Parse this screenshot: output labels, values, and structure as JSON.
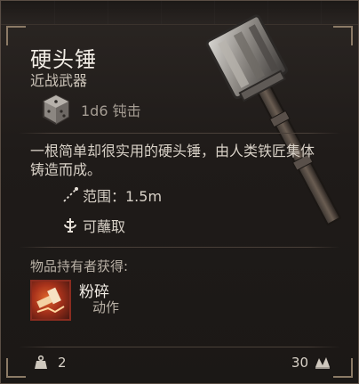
{
  "item": {
    "name": "硬头锤",
    "category": "近战武器",
    "damage": "1d6 钝击",
    "description": "一根简单却很实用的硬头锤，由人类铁匠集体铸造而成。",
    "properties": {
      "range_label": "范围：1.5m",
      "dippable_label": "可蘸取"
    },
    "holder_section_label": "物品持有者获得:",
    "action": {
      "name": "粉碎",
      "type": "动作"
    },
    "footer": {
      "weight": "2",
      "value": "30"
    },
    "icons": {
      "weapon": "hammer-icon",
      "dice": "d6-dice-icon",
      "range": "range-icon",
      "dip": "dip-icon",
      "action": "smash-icon",
      "weight": "weight-icon",
      "value": "gold-icon"
    }
  },
  "colors": {
    "title": "#f2ede6",
    "text": "#d8d1c7",
    "muted": "#a59d93",
    "action_red": "#a8321b"
  }
}
